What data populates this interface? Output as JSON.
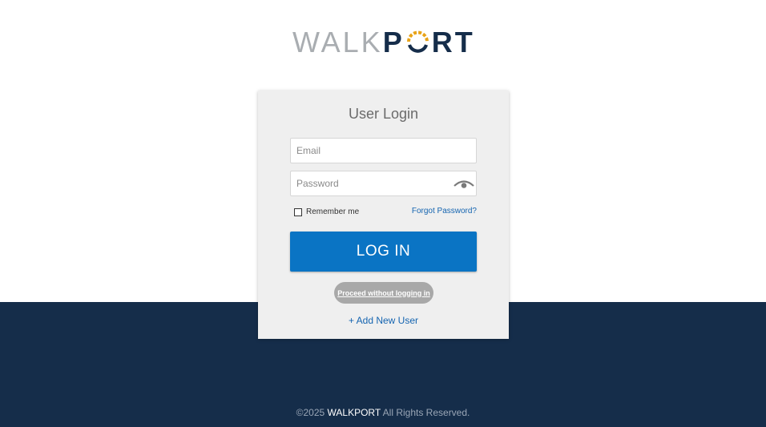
{
  "logo": {
    "text_light": "WALK",
    "text_dark_1": "P",
    "text_dark_2": "RT",
    "colors": {
      "light": "#a9adb1",
      "dark": "#152d4a",
      "accent": "#e8a317"
    }
  },
  "login": {
    "title": "User Login",
    "email_placeholder": "Email",
    "password_placeholder": "Password",
    "remember_label": "Remember me",
    "forgot_label": "Forgot Password?",
    "login_button": "LOG IN",
    "proceed_label": "Proceed without logging in",
    "add_user_label": "+ Add New User"
  },
  "footer": {
    "copyright": "©2025",
    "brand": "WALKPORT",
    "rights": "All Rights Reserved."
  },
  "colors": {
    "band": "#152d4a",
    "primary": "#0a74c4",
    "link": "#1464b0"
  }
}
